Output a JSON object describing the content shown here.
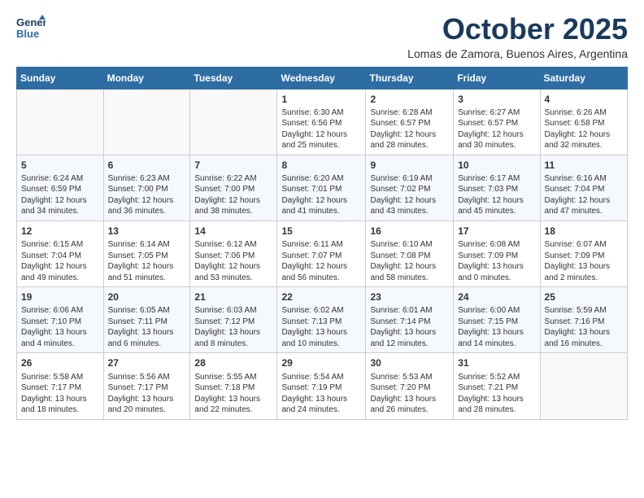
{
  "header": {
    "logo_line1": "General",
    "logo_line2": "Blue",
    "month": "October 2025",
    "location": "Lomas de Zamora, Buenos Aires, Argentina"
  },
  "weekdays": [
    "Sunday",
    "Monday",
    "Tuesday",
    "Wednesday",
    "Thursday",
    "Friday",
    "Saturday"
  ],
  "weeks": [
    [
      {
        "day": "",
        "text": ""
      },
      {
        "day": "",
        "text": ""
      },
      {
        "day": "",
        "text": ""
      },
      {
        "day": "1",
        "text": "Sunrise: 6:30 AM\nSunset: 6:56 PM\nDaylight: 12 hours\nand 25 minutes."
      },
      {
        "day": "2",
        "text": "Sunrise: 6:28 AM\nSunset: 6:57 PM\nDaylight: 12 hours\nand 28 minutes."
      },
      {
        "day": "3",
        "text": "Sunrise: 6:27 AM\nSunset: 6:57 PM\nDaylight: 12 hours\nand 30 minutes."
      },
      {
        "day": "4",
        "text": "Sunrise: 6:26 AM\nSunset: 6:58 PM\nDaylight: 12 hours\nand 32 minutes."
      }
    ],
    [
      {
        "day": "5",
        "text": "Sunrise: 6:24 AM\nSunset: 6:59 PM\nDaylight: 12 hours\nand 34 minutes."
      },
      {
        "day": "6",
        "text": "Sunrise: 6:23 AM\nSunset: 7:00 PM\nDaylight: 12 hours\nand 36 minutes."
      },
      {
        "day": "7",
        "text": "Sunrise: 6:22 AM\nSunset: 7:00 PM\nDaylight: 12 hours\nand 38 minutes."
      },
      {
        "day": "8",
        "text": "Sunrise: 6:20 AM\nSunset: 7:01 PM\nDaylight: 12 hours\nand 41 minutes."
      },
      {
        "day": "9",
        "text": "Sunrise: 6:19 AM\nSunset: 7:02 PM\nDaylight: 12 hours\nand 43 minutes."
      },
      {
        "day": "10",
        "text": "Sunrise: 6:17 AM\nSunset: 7:03 PM\nDaylight: 12 hours\nand 45 minutes."
      },
      {
        "day": "11",
        "text": "Sunrise: 6:16 AM\nSunset: 7:04 PM\nDaylight: 12 hours\nand 47 minutes."
      }
    ],
    [
      {
        "day": "12",
        "text": "Sunrise: 6:15 AM\nSunset: 7:04 PM\nDaylight: 12 hours\nand 49 minutes."
      },
      {
        "day": "13",
        "text": "Sunrise: 6:14 AM\nSunset: 7:05 PM\nDaylight: 12 hours\nand 51 minutes."
      },
      {
        "day": "14",
        "text": "Sunrise: 6:12 AM\nSunset: 7:06 PM\nDaylight: 12 hours\nand 53 minutes."
      },
      {
        "day": "15",
        "text": "Sunrise: 6:11 AM\nSunset: 7:07 PM\nDaylight: 12 hours\nand 56 minutes."
      },
      {
        "day": "16",
        "text": "Sunrise: 6:10 AM\nSunset: 7:08 PM\nDaylight: 12 hours\nand 58 minutes."
      },
      {
        "day": "17",
        "text": "Sunrise: 6:08 AM\nSunset: 7:09 PM\nDaylight: 13 hours\nand 0 minutes."
      },
      {
        "day": "18",
        "text": "Sunrise: 6:07 AM\nSunset: 7:09 PM\nDaylight: 13 hours\nand 2 minutes."
      }
    ],
    [
      {
        "day": "19",
        "text": "Sunrise: 6:06 AM\nSunset: 7:10 PM\nDaylight: 13 hours\nand 4 minutes."
      },
      {
        "day": "20",
        "text": "Sunrise: 6:05 AM\nSunset: 7:11 PM\nDaylight: 13 hours\nand 6 minutes."
      },
      {
        "day": "21",
        "text": "Sunrise: 6:03 AM\nSunset: 7:12 PM\nDaylight: 13 hours\nand 8 minutes."
      },
      {
        "day": "22",
        "text": "Sunrise: 6:02 AM\nSunset: 7:13 PM\nDaylight: 13 hours\nand 10 minutes."
      },
      {
        "day": "23",
        "text": "Sunrise: 6:01 AM\nSunset: 7:14 PM\nDaylight: 13 hours\nand 12 minutes."
      },
      {
        "day": "24",
        "text": "Sunrise: 6:00 AM\nSunset: 7:15 PM\nDaylight: 13 hours\nand 14 minutes."
      },
      {
        "day": "25",
        "text": "Sunrise: 5:59 AM\nSunset: 7:16 PM\nDaylight: 13 hours\nand 16 minutes."
      }
    ],
    [
      {
        "day": "26",
        "text": "Sunrise: 5:58 AM\nSunset: 7:17 PM\nDaylight: 13 hours\nand 18 minutes."
      },
      {
        "day": "27",
        "text": "Sunrise: 5:56 AM\nSunset: 7:17 PM\nDaylight: 13 hours\nand 20 minutes."
      },
      {
        "day": "28",
        "text": "Sunrise: 5:55 AM\nSunset: 7:18 PM\nDaylight: 13 hours\nand 22 minutes."
      },
      {
        "day": "29",
        "text": "Sunrise: 5:54 AM\nSunset: 7:19 PM\nDaylight: 13 hours\nand 24 minutes."
      },
      {
        "day": "30",
        "text": "Sunrise: 5:53 AM\nSunset: 7:20 PM\nDaylight: 13 hours\nand 26 minutes."
      },
      {
        "day": "31",
        "text": "Sunrise: 5:52 AM\nSunset: 7:21 PM\nDaylight: 13 hours\nand 28 minutes."
      },
      {
        "day": "",
        "text": ""
      }
    ]
  ]
}
